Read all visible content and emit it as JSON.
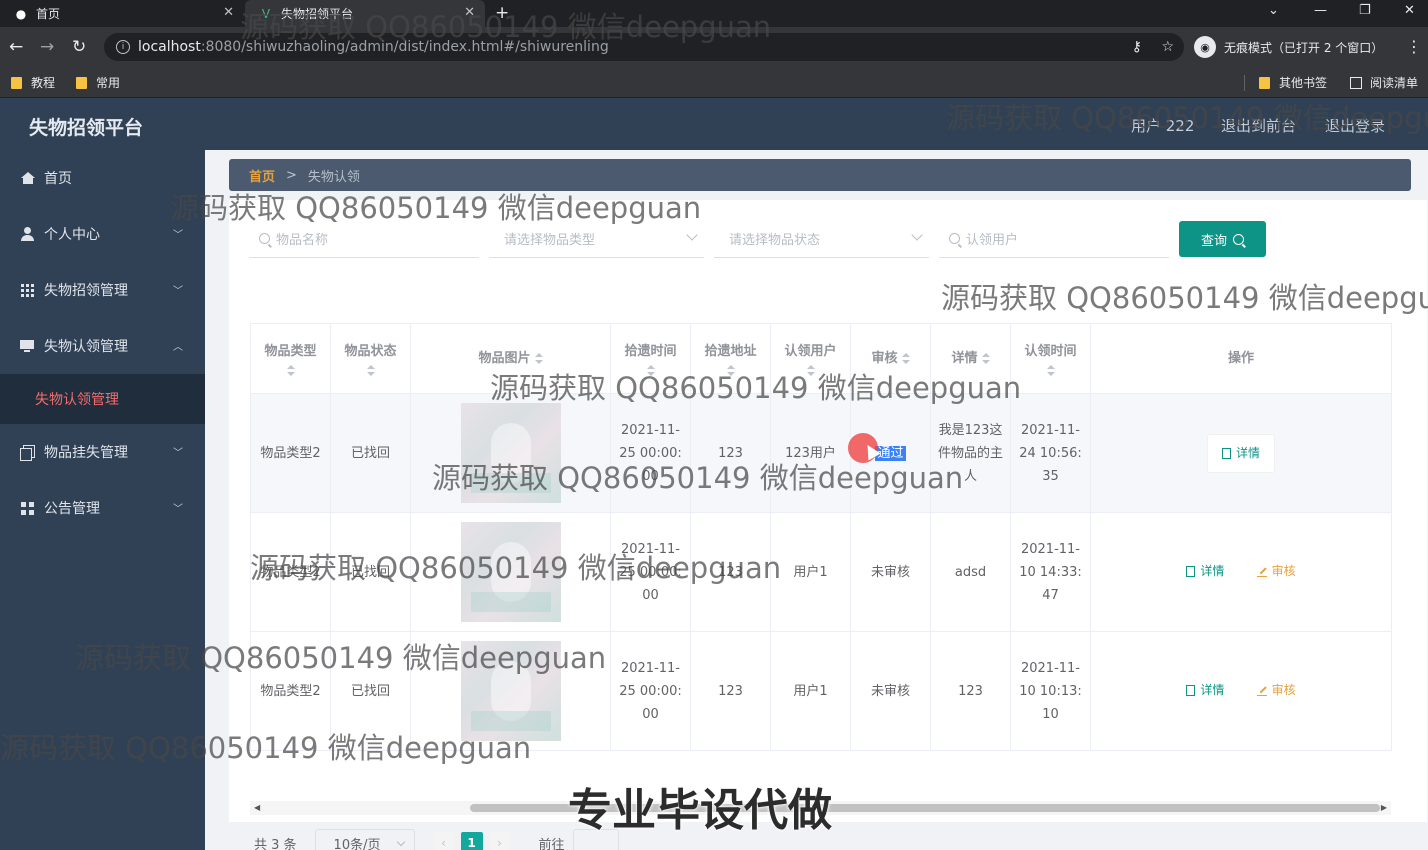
{
  "browser": {
    "tabs": [
      {
        "label": "首页",
        "active": false
      },
      {
        "label": "失物招领平台",
        "active": true
      }
    ],
    "url_host": "localhost",
    "url_path": ":8080/shiwuzhaoling/admin/dist/index.html#/shiwurenling",
    "incognito_label": "无痕模式（已打开 2 个窗口）",
    "bookmarks": [
      "教程",
      "常用"
    ],
    "bookmarks_right": [
      "其他书签",
      "阅读清单"
    ]
  },
  "header": {
    "title": "失物招领平台",
    "user": "用户 222",
    "back_to_front": "退出到前台",
    "logout": "退出登录"
  },
  "sidebar": {
    "items": [
      {
        "label": "首页",
        "icon": "home-icon"
      },
      {
        "label": "个人中心",
        "icon": "user-icon"
      },
      {
        "label": "失物招领管理",
        "icon": "grid-icon"
      },
      {
        "label": "失物认领管理",
        "icon": "monitor-icon",
        "expanded": true
      },
      {
        "label": "物品挂失管理",
        "icon": "copy-icon"
      },
      {
        "label": "公告管理",
        "icon": "apps-icon"
      }
    ],
    "active_sub": "失物认领管理"
  },
  "breadcrumb": {
    "home": "首页",
    "sep": ">",
    "current": "失物认领"
  },
  "search": {
    "name_placeholder": "物品名称",
    "type_placeholder": "请选择物品类型",
    "status_placeholder": "请选择物品状态",
    "user_placeholder": "认领用户",
    "query_label": "查询"
  },
  "table": {
    "headers": [
      "物品类型",
      "物品状态",
      "物品图片",
      "拾遗时间",
      "拾遗地址",
      "认领用户",
      "审核",
      "详情",
      "认领时间",
      "操作"
    ],
    "rows": [
      {
        "type": "物品类型2",
        "status": "已找回",
        "time": "2021-11-25 00:00:00",
        "address": "123",
        "user": "123用户",
        "audit": "通过",
        "detail": "我是123这件物品的主人",
        "claim_time": "2021-11-24 10:56:35",
        "actions": [
          "详情"
        ]
      },
      {
        "type": "物品类型2",
        "status": "已找回",
        "time": "2021-11-25 00:00:00",
        "address": "123",
        "user": "用户1",
        "audit": "未审核",
        "detail": "adsd",
        "claim_time": "2021-11-10 14:33:47",
        "actions": [
          "详情",
          "审核"
        ]
      },
      {
        "type": "物品类型2",
        "status": "已找回",
        "time": "2021-11-25 00:00:00",
        "address": "123",
        "user": "用户1",
        "audit": "未审核",
        "detail": "123",
        "claim_time": "2021-11-10 10:13:10",
        "actions": [
          "详情",
          "审核"
        ]
      }
    ]
  },
  "pager": {
    "total": "共 3 条",
    "page_size": "10条/页",
    "current_page": "1",
    "goto": "前往",
    "prev": "‹",
    "next": "›"
  },
  "watermark": "源码获取 QQ86050149 微信deepguan",
  "banner": "专业毕设代做",
  "colors": {
    "sidebar": "#304156",
    "accent": "#0d9487",
    "audit": "#e6a23c",
    "active_menu": "#f56c6c"
  }
}
